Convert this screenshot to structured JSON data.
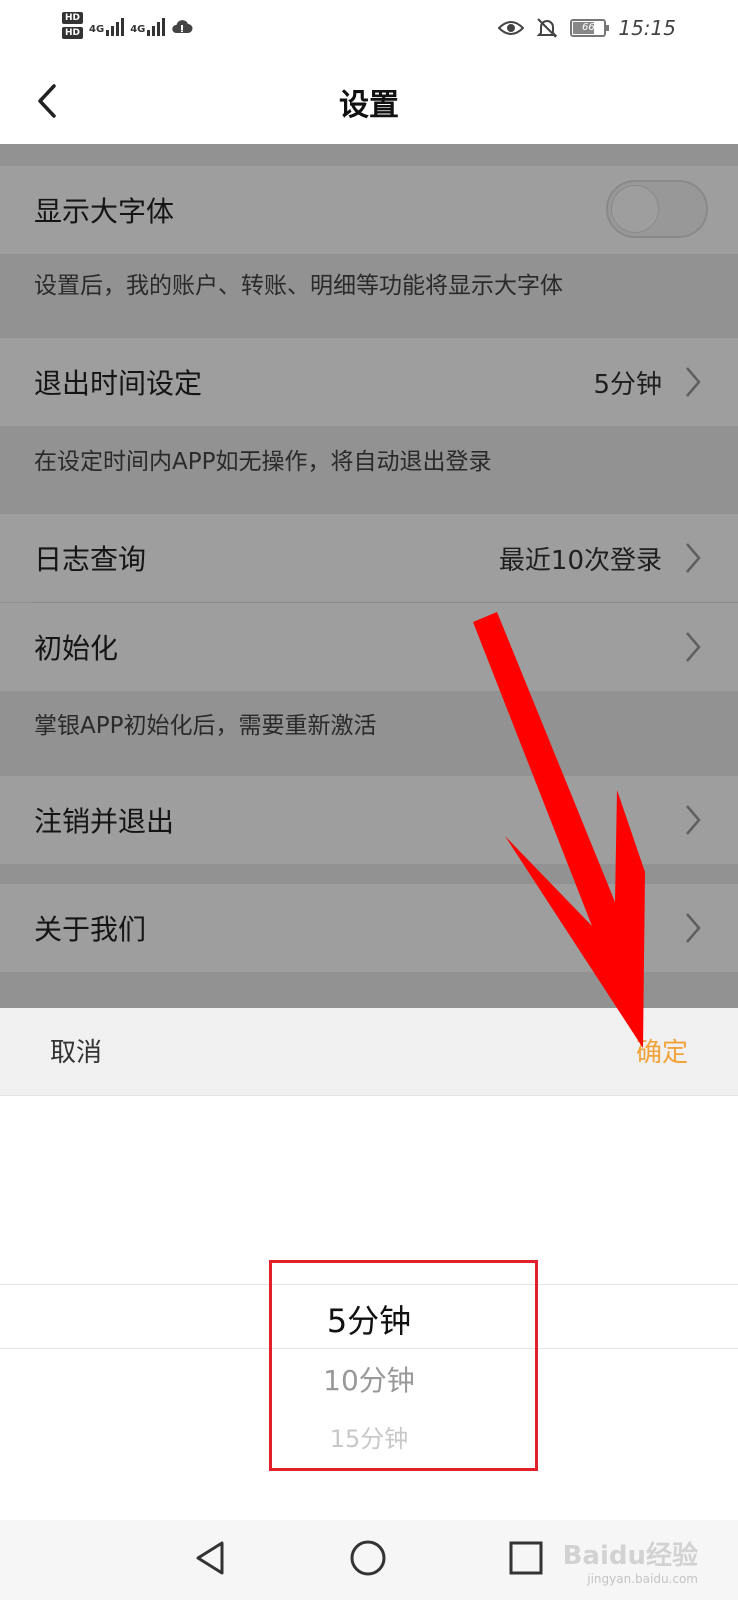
{
  "status_bar": {
    "hd1": "HD",
    "hd2": "HD",
    "net1": "4G",
    "net2": "4G",
    "battery": "66",
    "time": "15:15",
    "icons": [
      "eye-icon",
      "bell-off-icon",
      "cloud-icon",
      "signal-icon"
    ]
  },
  "header": {
    "title": "设置",
    "back_icon": "back-chevron-icon"
  },
  "settings": {
    "large_font": {
      "label": "显示大字体",
      "enabled": false,
      "desc": "设置后，我的账户、转账、明细等功能将显示大字体"
    },
    "logout_time": {
      "label": "退出时间设定",
      "value": "5分钟",
      "desc": "在设定时间内APP如无操作，将自动退出登录"
    },
    "log_query": {
      "label": "日志查询",
      "value": "最近10次登录"
    },
    "init": {
      "label": "初始化",
      "desc": "掌银APP初始化后，需要重新激活"
    },
    "logout": {
      "label": "注销并退出"
    },
    "about": {
      "label": "关于我们"
    }
  },
  "picker": {
    "cancel": "取消",
    "confirm": "确定",
    "options": [
      "5分钟",
      "10分钟",
      "15分钟"
    ],
    "selected_index": 0
  },
  "colors": {
    "accent": "#f2a33a",
    "annotation_red": "#ff0000",
    "box_red": "#e0202a"
  },
  "nav": {
    "back": "nav-back-icon",
    "home": "nav-home-icon",
    "recents": "nav-recents-icon"
  },
  "watermark": {
    "brand": "Baidu经验",
    "url": "jingyan.baidu.com"
  }
}
